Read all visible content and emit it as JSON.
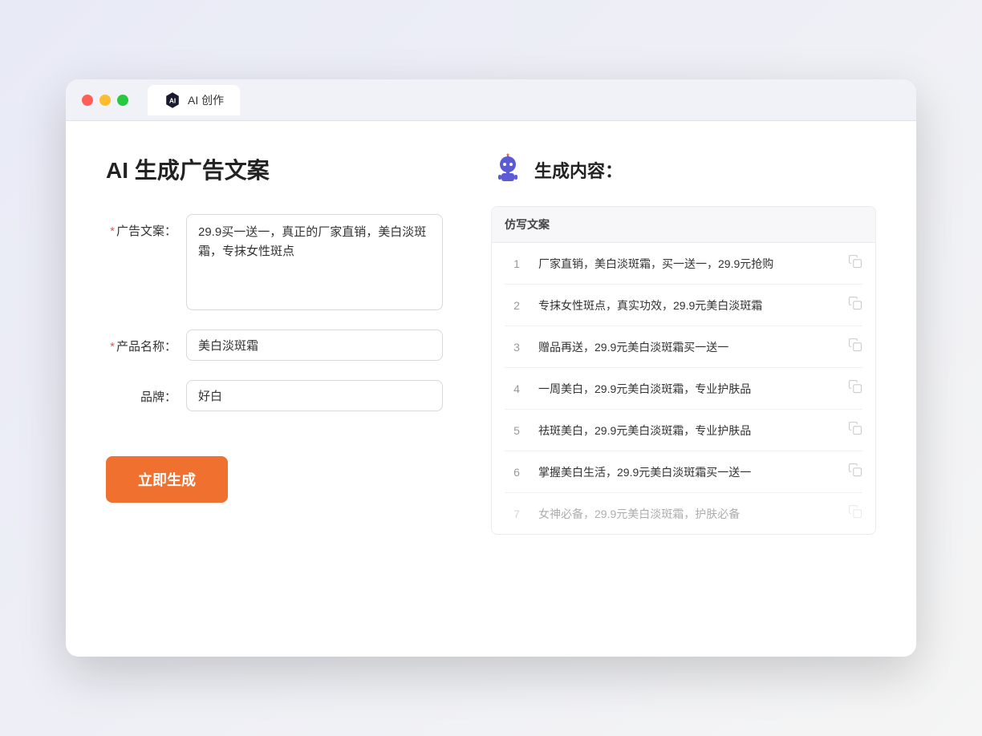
{
  "window": {
    "tab_label": "AI 创作"
  },
  "left_panel": {
    "title": "AI 生成广告文案",
    "fields": {
      "ad_copy": {
        "label": "广告文案：",
        "required": true,
        "value": "29.9买一送一，真正的厂家直销，美白淡斑霜，专抹女性斑点",
        "type": "textarea"
      },
      "product_name": {
        "label": "产品名称：",
        "required": true,
        "value": "美白淡斑霜",
        "type": "input"
      },
      "brand": {
        "label": "品牌：",
        "required": false,
        "value": "好白",
        "type": "input"
      }
    },
    "button_label": "立即生成"
  },
  "right_panel": {
    "title": "生成内容：",
    "table_header": "仿写文案",
    "results": [
      {
        "num": "1",
        "text": "厂家直销，美白淡斑霜，买一送一，29.9元抢购",
        "faded": false
      },
      {
        "num": "2",
        "text": "专抹女性斑点，真实功效，29.9元美白淡斑霜",
        "faded": false
      },
      {
        "num": "3",
        "text": "赠品再送，29.9元美白淡斑霜买一送一",
        "faded": false
      },
      {
        "num": "4",
        "text": "一周美白，29.9元美白淡斑霜，专业护肤品",
        "faded": false
      },
      {
        "num": "5",
        "text": "祛斑美白，29.9元美白淡斑霜，专业护肤品",
        "faded": false
      },
      {
        "num": "6",
        "text": "掌握美白生活，29.9元美白淡斑霜买一送一",
        "faded": false
      },
      {
        "num": "7",
        "text": "女神必备，29.9元美白淡斑霜，护肤必备",
        "faded": true
      }
    ]
  },
  "colors": {
    "required_star": "#ff4d4f",
    "generate_button": "#f07030",
    "accent": "#4a6cf7"
  }
}
